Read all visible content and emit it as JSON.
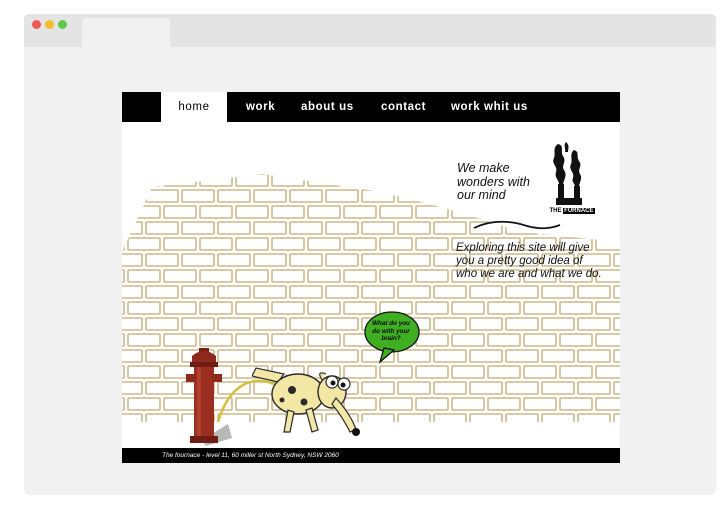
{
  "nav": {
    "items": [
      {
        "label": "home",
        "active": true
      },
      {
        "label": "work",
        "active": false
      },
      {
        "label": "about us",
        "active": false
      },
      {
        "label": "contact",
        "active": false
      },
      {
        "label": "work whit us",
        "active": false
      }
    ]
  },
  "hero": {
    "headline": "We make\nwonders with\nour mind",
    "tagline": "Exploring this site will give\nyou a pretty good idea of\nwho we are and what we do."
  },
  "logo": {
    "label_prefix": "THE",
    "label_name": "FURNACE"
  },
  "speech_bubble": {
    "text": "What do you\ndo with your\nbrain?"
  },
  "footer": {
    "text": "The fournace - level 11, 60 miller st North Sydney, NSW 2060"
  },
  "browser": {
    "dots": [
      "#ee5a52",
      "#f4bd2e",
      "#5fc84a"
    ]
  },
  "colors": {
    "nav_bg": "#000000",
    "bubble": "#3fae22",
    "hydrant": "#8e2a1d"
  }
}
